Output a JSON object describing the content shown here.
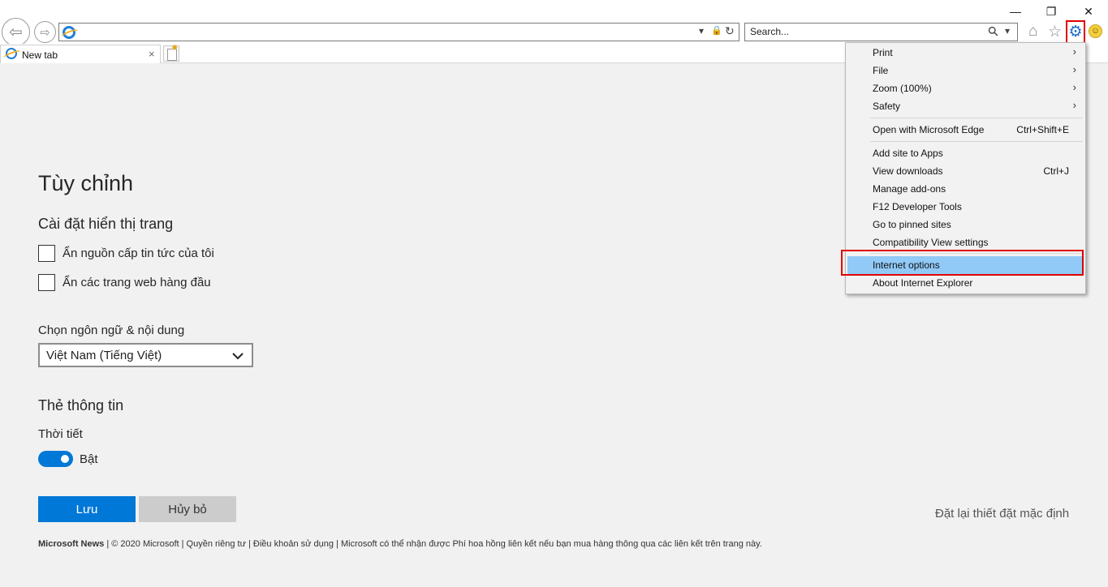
{
  "window": {
    "minimize": "—",
    "restore": "❐",
    "close": "✕"
  },
  "nav": {
    "back_icon": "⇦",
    "forward_icon": "⇨"
  },
  "address_bar": {
    "value": "",
    "dropdown_icon": "▾",
    "lock_icon": "🔒",
    "refresh_icon": "↻"
  },
  "search": {
    "placeholder": "Search...",
    "search_icon": "⚲",
    "dropdown_icon": "▾"
  },
  "toolbar": {
    "home_icon": "⌂",
    "favorites_icon": "☆",
    "tools_icon": "⚙",
    "feedback_icon": "☺"
  },
  "tabs": [
    {
      "label": "New tab",
      "close_icon": "×"
    }
  ],
  "page": {
    "title": "Tùy chỉnh",
    "display_section": "Cài đặt hiển thị trang",
    "checkboxes": [
      {
        "label": "Ẩn nguồn cấp tin tức của tôi",
        "checked": false
      },
      {
        "label": "Ẩn các trang web hàng đầu",
        "checked": false
      }
    ],
    "language_label": "Chọn ngôn ngữ & nội dung",
    "language_selected": "Việt Nam (Tiếng Việt)",
    "info_section": "Thẻ thông tin",
    "weather_label": "Thời tiết",
    "weather_toggle_label": "Bật",
    "weather_toggle_on": true,
    "save_label": "Lưu",
    "cancel_label": "Hủy bỏ",
    "reset_label": "Đặt lại thiết đặt mặc định",
    "footer_brand": "Microsoft News",
    "footer_text": " | © 2020 Microsoft | Quyền riêng tư | Điều khoản sử dụng | Microsoft có thể nhận được Phí hoa hồng liên kết nếu bạn mua hàng thông qua các liên kết trên trang này."
  },
  "menu": {
    "items": [
      {
        "label": "Print",
        "arrow": "›"
      },
      {
        "label": "File",
        "arrow": "›"
      },
      {
        "label": "Zoom (100%)",
        "arrow": "›"
      },
      {
        "label": "Safety",
        "arrow": "›"
      },
      {
        "label": "Open with Microsoft Edge",
        "shortcut": "Ctrl+Shift+E"
      },
      {
        "label": "Add site to Apps"
      },
      {
        "label": "View downloads",
        "shortcut": "Ctrl+J"
      },
      {
        "label": "Manage add-ons"
      },
      {
        "label": "F12 Developer Tools"
      },
      {
        "label": "Go to pinned sites"
      },
      {
        "label": "Compatibility View settings"
      },
      {
        "label": "Internet options",
        "highlighted": true
      },
      {
        "label": "About Internet Explorer"
      }
    ]
  },
  "colors": {
    "accent": "#0078d7",
    "menu_highlight": "#91c9f7",
    "annotation_red": "#e00000"
  }
}
